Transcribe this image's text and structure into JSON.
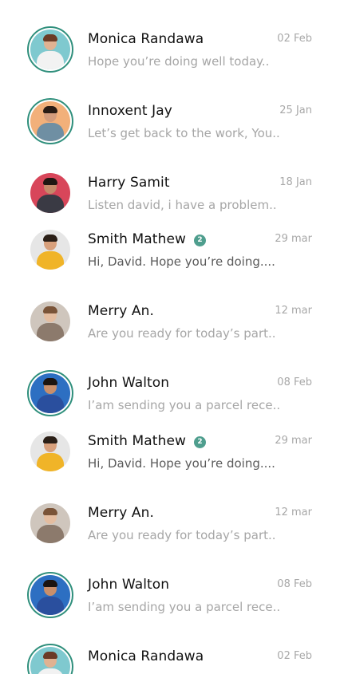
{
  "colors": {
    "accent": "#2f8f7c",
    "badge": "#4f9e8e",
    "name_text": "#111111",
    "muted_text": "#a6a6a6",
    "unread_text": "#5a5a5a"
  },
  "conversations": [
    {
      "name": "Monica Randawa",
      "date": "02 Feb",
      "message": "Hope you’re doing well today..",
      "unread": false,
      "badge": "",
      "avatar": "female-avatar"
    },
    {
      "name": "Innoxent Jay",
      "date": "25 Jan",
      "message": "Let’s get back to the work, You..",
      "unread": false,
      "badge": "",
      "avatar": "male-avatar"
    },
    {
      "name": "Harry Samit",
      "date": "18 Jan",
      "message": "Listen david, i have a problem..",
      "unread": false,
      "badge": "",
      "avatar": "male-avatar"
    },
    {
      "name": "Smith Mathew",
      "date": "29 mar",
      "message": "Hi, David. Hope you’re doing....",
      "unread": true,
      "badge": "2",
      "avatar": "male-avatar"
    },
    {
      "name": "Merry An.",
      "date": "12 mar",
      "message": "Are you ready for today’s part..",
      "unread": false,
      "badge": "",
      "avatar": "female-avatar"
    },
    {
      "name": "John Walton",
      "date": "08 Feb",
      "message": "I’am sending you a parcel rece..",
      "unread": false,
      "badge": "",
      "avatar": "male-avatar"
    },
    {
      "name": "Smith Mathew",
      "date": "29 mar",
      "message": "Hi, David. Hope you’re doing....",
      "unread": true,
      "badge": "2",
      "avatar": "male-avatar"
    },
    {
      "name": "Merry An.",
      "date": "12 mar",
      "message": "Are you ready for today’s part..",
      "unread": false,
      "badge": "",
      "avatar": "female-avatar"
    },
    {
      "name": "John Walton",
      "date": "08 Feb",
      "message": "I’am sending you a parcel rece..",
      "unread": false,
      "badge": "",
      "avatar": "male-avatar"
    },
    {
      "name": "Monica Randawa",
      "date": "02 Feb",
      "message": "",
      "unread": false,
      "badge": "",
      "avatar": "female-avatar"
    }
  ]
}
